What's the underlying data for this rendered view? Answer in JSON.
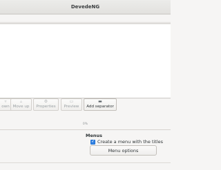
{
  "window": {
    "title": "DevedeNG"
  },
  "toolbar": {
    "buttons": [
      {
        "label": "own",
        "icon": "move-down-icon",
        "enabled": false
      },
      {
        "label": "Move up",
        "icon": "move-up-icon",
        "enabled": false
      },
      {
        "label": "Properties",
        "icon": "properties-icon",
        "enabled": false
      },
      {
        "label": "Preview",
        "icon": "preview-icon",
        "enabled": false
      },
      {
        "label": "Add separator",
        "icon": "add-separator-icon",
        "enabled": true
      }
    ]
  },
  "progress": {
    "text": "0%",
    "value": 0
  },
  "menus": {
    "title": "Menus",
    "create_menu_label": "Create a menu with the titles",
    "create_menu_checked": true,
    "menu_options_label": "Menu options"
  },
  "colors": {
    "accent": "#3584e4",
    "background": "#f6f5f4",
    "list_background": "#ffffff"
  }
}
